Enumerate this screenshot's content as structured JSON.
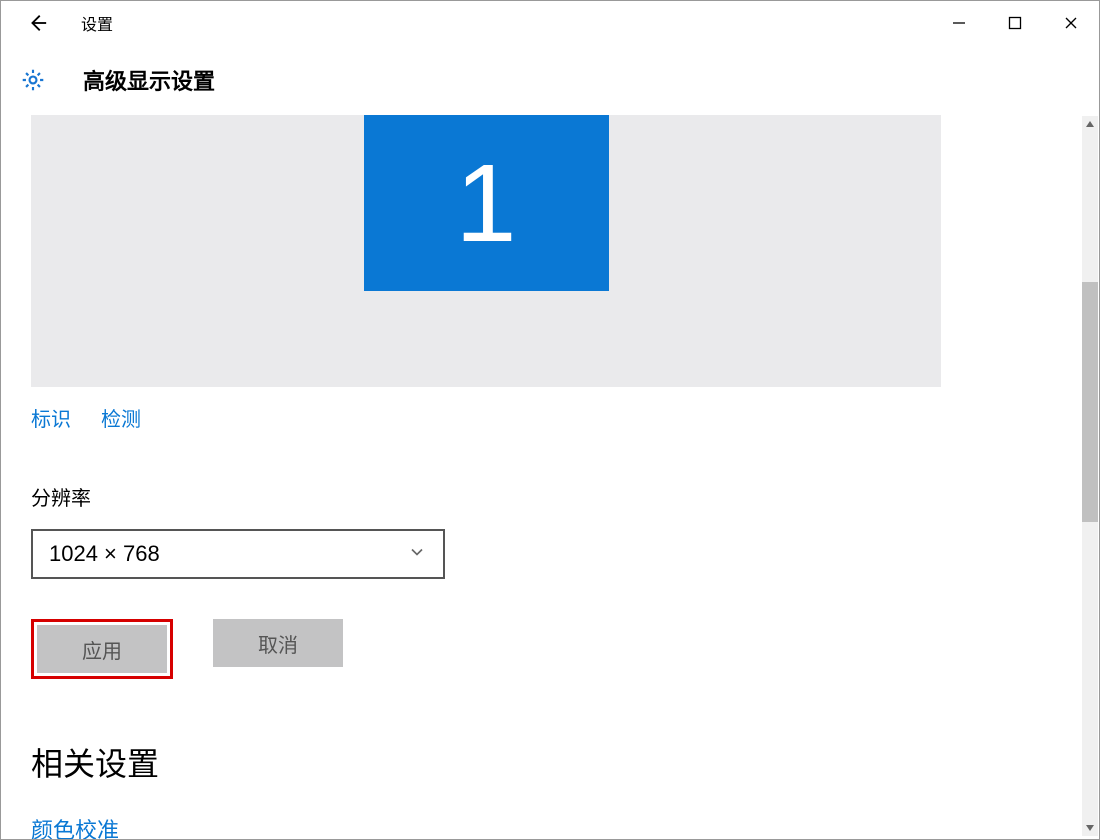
{
  "titlebar": {
    "back_tooltip": "Back",
    "app_title": "设置"
  },
  "header": {
    "page_title": "高级显示设置"
  },
  "display": {
    "monitor_label": "1"
  },
  "links": {
    "identify": "标识",
    "detect": "检测"
  },
  "resolution": {
    "label": "分辨率",
    "value": "1024 × 768"
  },
  "buttons": {
    "apply": "应用",
    "cancel": "取消"
  },
  "related": {
    "heading": "相关设置",
    "color_calibration": "颜色校准"
  }
}
